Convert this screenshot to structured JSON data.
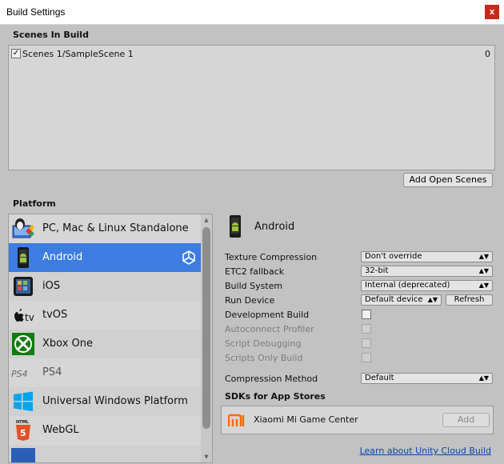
{
  "window": {
    "title": "Build Settings",
    "close_label": "x"
  },
  "scenes": {
    "header": "Scenes In Build",
    "items": [
      {
        "checked": true,
        "name": "Scenes 1/SampleScene 1",
        "index": "0"
      }
    ],
    "add_open_scenes_label": "Add Open Scenes"
  },
  "platform": {
    "header": "Platform",
    "items": [
      {
        "label": "PC, Mac & Linux Standalone",
        "icon": "pc-mac-linux-icon",
        "selected": false
      },
      {
        "label": "Android",
        "icon": "android-icon",
        "selected": true
      },
      {
        "label": "iOS",
        "icon": "ios-icon",
        "selected": false
      },
      {
        "label": "tvOS",
        "icon": "appletv-icon",
        "selected": false
      },
      {
        "label": "Xbox One",
        "icon": "xbox-icon",
        "selected": false
      },
      {
        "label": "PS4",
        "icon": "ps4-icon",
        "selected": false
      },
      {
        "label": "Universal Windows Platform",
        "icon": "windows-icon",
        "selected": false
      },
      {
        "label": "WebGL",
        "icon": "html5-icon",
        "selected": false
      }
    ]
  },
  "settings": {
    "platform_title": "Android",
    "texture_compression": {
      "label": "Texture Compression",
      "value": "Don't override"
    },
    "etc2_fallback": {
      "label": "ETC2 fallback",
      "value": "32-bit"
    },
    "build_system": {
      "label": "Build System",
      "value": "Internal (deprecated)"
    },
    "run_device": {
      "label": "Run Device",
      "value": "Default device",
      "refresh_label": "Refresh"
    },
    "development_build": {
      "label": "Development Build",
      "checked": false
    },
    "autoconnect_profiler": {
      "label": "Autoconnect Profiler",
      "checked": false
    },
    "script_debugging": {
      "label": "Script Debugging",
      "checked": false
    },
    "scripts_only_build": {
      "label": "Scripts Only Build",
      "checked": false
    },
    "compression_method": {
      "label": "Compression Method",
      "value": "Default"
    },
    "sdks_header": "SDKs for App Stores",
    "sdk_item": {
      "label": "Xiaomi Mi Game Center",
      "add_label": "Add"
    },
    "cloud_link": "Learn about Unity Cloud Build"
  },
  "colors": {
    "selected_row": "#3d7ce0",
    "panel_bg": "#c2c2c2",
    "link": "#0645ad"
  }
}
